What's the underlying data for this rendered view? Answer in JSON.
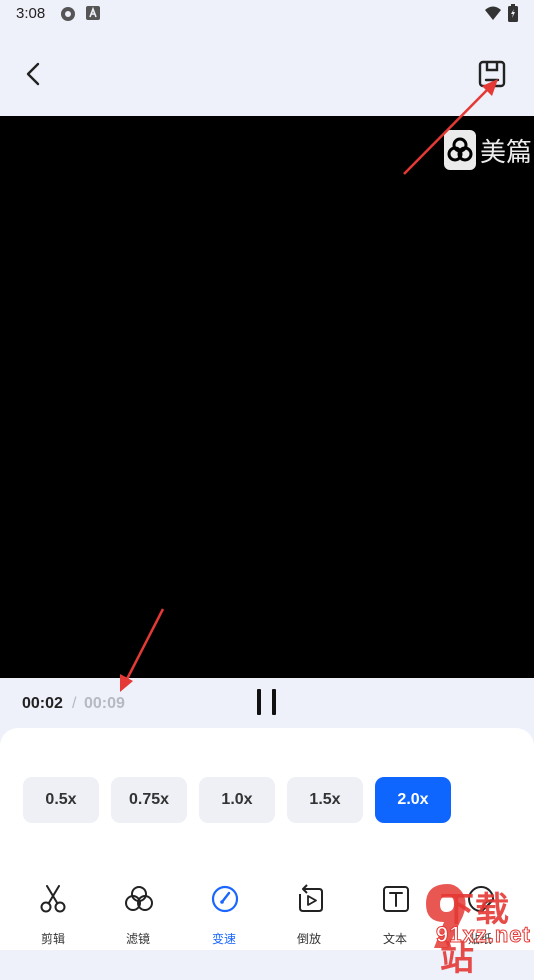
{
  "status": {
    "time": "3:08"
  },
  "watermark": {
    "brand": "美篇"
  },
  "timeline": {
    "current": "00:02",
    "separator": "/",
    "total": "00:09"
  },
  "speeds": [
    {
      "label": "0.5x",
      "active": false
    },
    {
      "label": "0.75x",
      "active": false
    },
    {
      "label": "1.0x",
      "active": false
    },
    {
      "label": "1.5x",
      "active": false
    },
    {
      "label": "2.0x",
      "active": true
    }
  ],
  "tools": [
    {
      "label": "剪辑",
      "icon": "scissors-icon"
    },
    {
      "label": "滤镜",
      "icon": "filter-icon"
    },
    {
      "label": "变速",
      "icon": "speed-icon",
      "active": true
    },
    {
      "label": "倒放",
      "icon": "reverse-icon"
    },
    {
      "label": "文本",
      "icon": "text-icon"
    },
    {
      "label": "贴纸",
      "icon": "sticker-icon"
    }
  ],
  "site_watermark": {
    "big": "下载站",
    "url": "91xz.net"
  },
  "colors": {
    "accent": "#0f66ff",
    "annotation": "#e53935"
  }
}
